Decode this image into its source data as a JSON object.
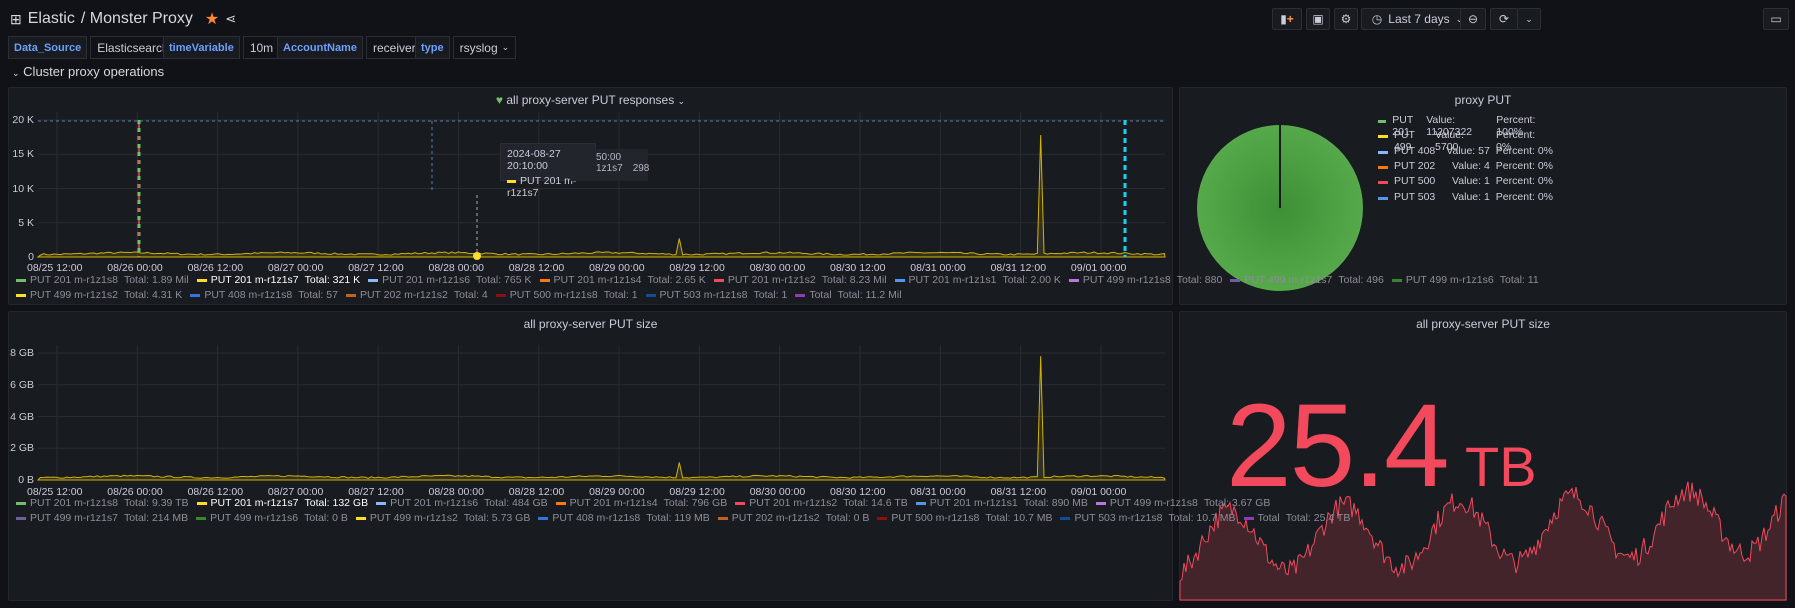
{
  "header": {
    "org": "Elastic",
    "dashboard": "/ Monster Proxy",
    "time_range": "Last 7 days"
  },
  "variables": [
    {
      "label": "Data_Source",
      "value": "Elasticsearch"
    },
    {
      "label": "timeVariable",
      "value": "10m"
    },
    {
      "label": "AccountName",
      "value": "receiver"
    },
    {
      "label": "type",
      "value": "rsyslog"
    }
  ],
  "row_title": "Cluster proxy operations",
  "panel1": {
    "title": "all proxy-server PUT responses",
    "yticks": [
      "20 K",
      "15 K",
      "10 K",
      "5 K",
      "0"
    ],
    "tooltip": {
      "time": "2024-08-27 20:10:00",
      "series": "PUT 201 m-r1z1s7",
      "ghost_time": "50:00",
      "ghost_series": "1z1s7",
      "ghost_value": "298"
    },
    "legend": [
      {
        "name": "PUT 201 m-r1z1s8",
        "total": "Total: 1.89 Mil",
        "color": "#73bf69"
      },
      {
        "name": "PUT 201 m-r1z1s7",
        "total": "Total: 321 K",
        "color": "#fade2a",
        "hl": true
      },
      {
        "name": "PUT 201 m-r1z1s6",
        "total": "Total: 765 K",
        "color": "#8ab8ff"
      },
      {
        "name": "PUT 201 m-r1z1s4",
        "total": "Total: 2.65 K",
        "color": "#ff780a"
      },
      {
        "name": "PUT 201 m-r1z1s2",
        "total": "Total: 8.23 Mil",
        "color": "#f2495c"
      },
      {
        "name": "PUT 201 m-r1z1s1",
        "total": "Total: 2.00 K",
        "color": "#5794f2"
      },
      {
        "name": "PUT 499 m-r1z1s8",
        "total": "Total: 880",
        "color": "#b877d9"
      },
      {
        "name": "PUT 499 m-r1z1s7",
        "total": "Total: 496",
        "color": "#705da0"
      },
      {
        "name": "PUT 499 m-r1z1s6",
        "total": "Total: 11",
        "color": "#37872d"
      },
      {
        "name": "PUT 499 m-r1z1s2",
        "total": "Total: 4.31 K",
        "color": "#fade2a"
      },
      {
        "name": "PUT 408 m-r1z1s8",
        "total": "Total: 57",
        "color": "#3274d9"
      },
      {
        "name": "PUT 202 m-r1z1s2",
        "total": "Total: 4",
        "color": "#c4621d"
      },
      {
        "name": "PUT 500 m-r1z1s8",
        "total": "Total: 1",
        "color": "#8f1010"
      },
      {
        "name": "PUT 503 m-r1z1s8",
        "total": "Total: 1",
        "color": "#114d92"
      },
      {
        "name": "Total",
        "total": "Total: 11.2 Mil",
        "color": "#8f3bb8"
      }
    ]
  },
  "xticks": [
    "08/25 12:00",
    "08/26 00:00",
    "08/26 12:00",
    "08/27 00:00",
    "08/27 12:00",
    "08/28 00:00",
    "08/28 12:00",
    "08/29 00:00",
    "08/29 12:00",
    "08/30 00:00",
    "08/30 12:00",
    "08/31 00:00",
    "08/31 12:00",
    "09/01 00:00"
  ],
  "panel2": {
    "title": "all proxy-server PUT size",
    "yticks": [
      "8 GB",
      "6 GB",
      "4 GB",
      "2 GB",
      "0 B"
    ],
    "legend": [
      {
        "name": "PUT 201 m-r1z1s8",
        "total": "Total: 9.39 TB",
        "color": "#73bf69"
      },
      {
        "name": "PUT 201 m-r1z1s7",
        "total": "Total: 132 GB",
        "color": "#fade2a",
        "hl": true
      },
      {
        "name": "PUT 201 m-r1z1s6",
        "total": "Total: 484 GB",
        "color": "#8ab8ff"
      },
      {
        "name": "PUT 201 m-r1z1s4",
        "total": "Total: 796 GB",
        "color": "#ff780a"
      },
      {
        "name": "PUT 201 m-r1z1s2",
        "total": "Total: 14.6 TB",
        "color": "#f2495c"
      },
      {
        "name": "PUT 201 m-r1z1s1",
        "total": "Total: 890 MB",
        "color": "#5794f2"
      },
      {
        "name": "PUT 499 m-r1z1s8",
        "total": "Total: 3.67 GB",
        "color": "#b877d9"
      },
      {
        "name": "PUT 499 m-r1z1s7",
        "total": "Total: 214 MB",
        "color": "#705da0"
      },
      {
        "name": "PUT 499 m-r1z1s6",
        "total": "Total: 0 B",
        "color": "#37872d"
      },
      {
        "name": "PUT 499 m-r1z1s2",
        "total": "Total: 5.73 GB",
        "color": "#fade2a"
      },
      {
        "name": "PUT 408 m-r1z1s8",
        "total": "Total: 119 MB",
        "color": "#3274d9"
      },
      {
        "name": "PUT 202 m-r1z1s2",
        "total": "Total: 0 B",
        "color": "#c4621d"
      },
      {
        "name": "PUT 500 m-r1z1s8",
        "total": "Total: 10.7 MB",
        "color": "#8f1010"
      },
      {
        "name": "PUT 503 m-r1z1s8",
        "total": "Total: 10.7 MB",
        "color": "#114d92"
      },
      {
        "name": "Total",
        "total": "Total: 25.4 TB",
        "color": "#8f3bb8"
      }
    ]
  },
  "pie": {
    "title": "proxy PUT",
    "items": [
      {
        "name": "PUT 201",
        "value": "Value: 11207322",
        "percent": "Percent: 100%",
        "color": "#73bf69"
      },
      {
        "name": "PUT 499",
        "value": "Value: 5700",
        "percent": "Percent: 0%",
        "color": "#fade2a"
      },
      {
        "name": "PUT 408",
        "value": "Value: 57",
        "percent": "Percent: 0%",
        "color": "#8ab8ff"
      },
      {
        "name": "PUT 202",
        "value": "Value: 4",
        "percent": "Percent: 0%",
        "color": "#ff780a"
      },
      {
        "name": "PUT 500",
        "value": "Value: 1",
        "percent": "Percent: 0%",
        "color": "#f2495c"
      },
      {
        "name": "PUT 503",
        "value": "Value: 1",
        "percent": "Percent: 0%",
        "color": "#5794f2"
      }
    ]
  },
  "stat": {
    "title": "all proxy-server PUT size",
    "value": "25.4",
    "unit": "TB",
    "color": "#f2495c"
  },
  "chart_data": [
    {
      "type": "line",
      "title": "all proxy-server PUT responses",
      "ylim": [
        0,
        20000
      ],
      "series_highlighted": "PUT 201 m-r1z1s7",
      "baseline": 500,
      "spikes": [
        {
          "x": "08/29 09:00",
          "y": 2700
        },
        {
          "x": "08/31 15:00",
          "y": 17800
        }
      ]
    },
    {
      "type": "line",
      "title": "all proxy-server PUT size",
      "ylim": [
        0,
        8
      ],
      "yunit": "GB",
      "series_highlighted": "PUT 201 m-r1z1s7",
      "baseline": 0.15,
      "spikes": [
        {
          "x": "08/29 09:00",
          "y": 1.1
        },
        {
          "x": "08/31 15:00",
          "y": 7.8
        }
      ]
    }
  ]
}
